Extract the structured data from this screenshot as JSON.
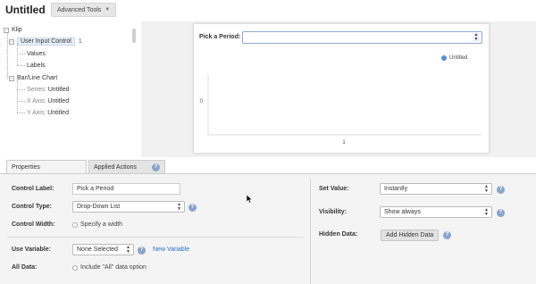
{
  "header": {
    "title": "Untitled",
    "advanced_tools_label": "Advanced Tools"
  },
  "tree": {
    "root": "Klip",
    "user_input_control": "User Input Control",
    "values": "Values",
    "labels": "Labels",
    "bar_line_chart": "Bar/Line Chart",
    "series_prefix": "Series:",
    "series_value": "Untitled",
    "xaxis_prefix": "X Axis:",
    "xaxis_value": "Untitled",
    "yaxis_prefix": "Y Axis:",
    "yaxis_value": "Untitled",
    "control_count": "1"
  },
  "preview": {
    "pick_label": "Pick a Period:",
    "pick_value": "",
    "legend_label": "Untitled",
    "legend_color": "#5b8ed8"
  },
  "chart_data": {
    "type": "bar",
    "categories": [
      "1"
    ],
    "series": [
      {
        "name": "Untitled",
        "values": [
          0
        ]
      }
    ],
    "y_tick_labels": [
      "0"
    ],
    "x_tick_labels": [
      "1"
    ],
    "legend": "top-right"
  },
  "tabs": {
    "properties": "Properties",
    "applied_actions": "Applied Actions"
  },
  "props": {
    "control_label_label": "Control Label:",
    "control_label_value": "Pick a Period",
    "control_type_label": "Control Type:",
    "control_type_value": "Drop-Down List",
    "control_width_label": "Control Width:",
    "specify_width": "Specify a width",
    "use_variable_label": "Use Variable:",
    "use_variable_value": "None Selected",
    "new_variable": "New Variable",
    "all_data_label": "All Data:",
    "include_all": "Include \"All\" data option",
    "set_value_label": "Set Value:",
    "set_value_value": "Instantly",
    "visibility_label": "Visibility:",
    "visibility_value": "Show always",
    "hidden_data_label": "Hidden Data:",
    "add_hidden_data": "Add Hidden Data",
    "info_glyph": "?"
  },
  "colors": {
    "accent": "#2a6fc9",
    "info": "#8aa4c8",
    "selection": "#e8eef8"
  }
}
